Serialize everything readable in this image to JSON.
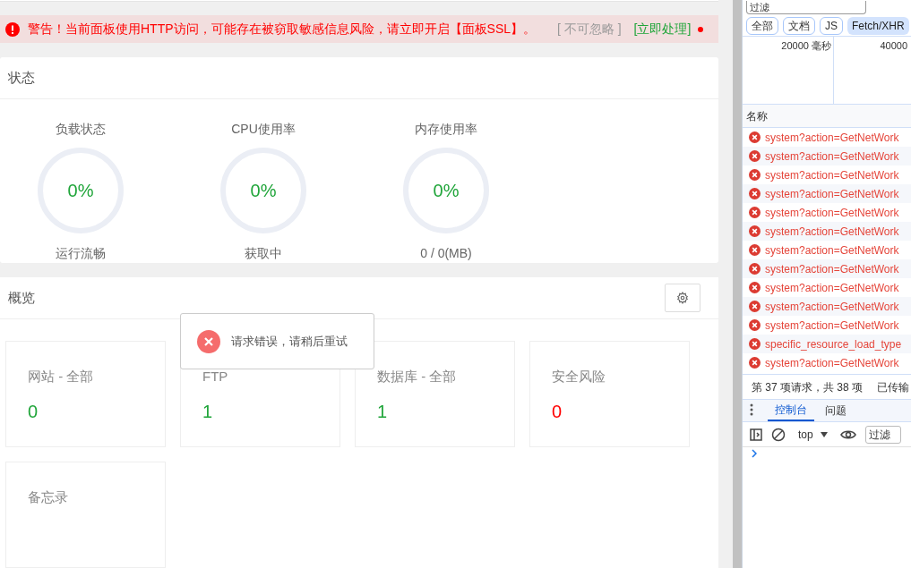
{
  "alert": {
    "text": "警告！当前面板使用HTTP访问，可能存在被窃取敏感信息风险，请立即开启【面板SSL】。",
    "ignore": "[ 不可忽略 ]",
    "action": "[立即处理]"
  },
  "status": {
    "title": "状态",
    "gauges": [
      {
        "label": "负载状态",
        "value": "0%",
        "caption": "运行流畅"
      },
      {
        "label": "CPU使用率",
        "value": "0%",
        "caption": "获取中"
      },
      {
        "label": "内存使用率",
        "value": "0%",
        "caption": "0 / 0(MB)"
      }
    ]
  },
  "overview": {
    "title": "概览",
    "cards": [
      {
        "label": "网站 - 全部",
        "value": "0",
        "color": "#20a53a"
      },
      {
        "label": "FTP",
        "value": "1",
        "color": "#20a53a"
      },
      {
        "label": "数据库 - 全部",
        "value": "1",
        "color": "#20a53a"
      },
      {
        "label": "安全风险",
        "value": "0",
        "color": "#ff0000"
      },
      {
        "label": "备忘录"
      }
    ]
  },
  "toast": {
    "text": "请求错误，请稍后重试"
  },
  "devtools": {
    "filter_placeholder": "过滤",
    "chips": [
      {
        "label": "全部",
        "selected": false
      },
      {
        "label": "文档",
        "selected": false
      },
      {
        "label": "JS",
        "selected": false
      },
      {
        "label": "Fetch/XHR",
        "selected": true
      }
    ],
    "ticks": [
      "20000 毫秒",
      "40000"
    ],
    "name_header": "名称",
    "requests": [
      "system?action=GetNetWork",
      "system?action=GetNetWork",
      "system?action=GetNetWork",
      "system?action=GetNetWork",
      "system?action=GetNetWork",
      "system?action=GetNetWork",
      "system?action=GetNetWork",
      "system?action=GetNetWork",
      "system?action=GetNetWork",
      "system?action=GetNetWork",
      "system?action=GetNetWork",
      "specific_resource_load_type",
      "system?action=GetNetWork"
    ],
    "summary": "第 37 项请求，共 38 项",
    "transferred": "已传输",
    "tabs": [
      {
        "label": "控制台",
        "selected": true
      },
      {
        "label": "问题",
        "selected": false
      }
    ],
    "context": "top",
    "console_filter": "过滤"
  }
}
